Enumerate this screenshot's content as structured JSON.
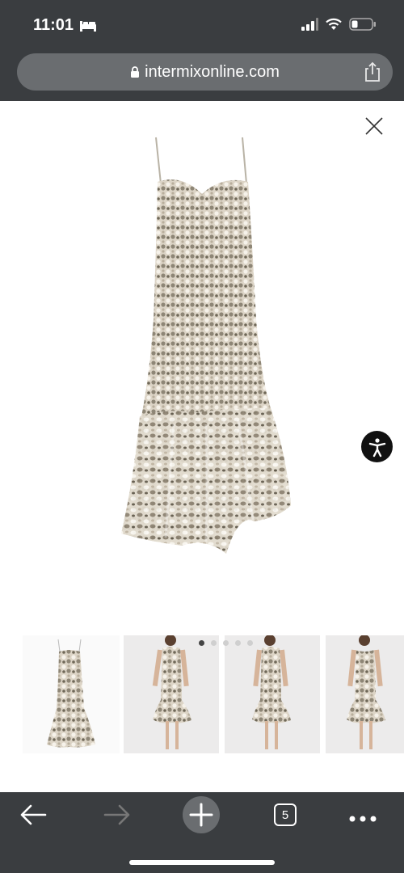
{
  "status_bar": {
    "time": "11:01",
    "sleep_icon": "bed-icon",
    "signal_icon": "cellular-signal-icon",
    "wifi_icon": "wifi-icon",
    "battery_icon": "battery-low-icon"
  },
  "browser": {
    "url": "intermixonline.com",
    "lock_icon": "lock-icon",
    "share_icon": "share-icon",
    "tab_count": "5"
  },
  "product": {
    "close_icon": "close-icon",
    "main_image_icon": "sequin-dress-image",
    "accessibility_icon": "accessibility-icon",
    "carousel": {
      "total_dots": 5,
      "active_index": 0
    },
    "thumbnails": [
      {
        "name": "dress-flat-thumbnail"
      },
      {
        "name": "dress-model-front-thumbnail"
      },
      {
        "name": "dress-model-front-2-thumbnail"
      },
      {
        "name": "dress-model-back-thumbnail"
      }
    ]
  },
  "bottom_nav": {
    "back_icon": "back-arrow-icon",
    "forward_icon": "forward-arrow-icon",
    "new_tab_icon": "plus-icon",
    "tabs_icon": "tabs-icon",
    "more_icon": "more-dots-icon"
  },
  "colors": {
    "chrome": "#3a3d40",
    "url_bar": "#6a6d70",
    "dress_light": "#e9e2d6",
    "dress_dark": "#8a8070"
  }
}
